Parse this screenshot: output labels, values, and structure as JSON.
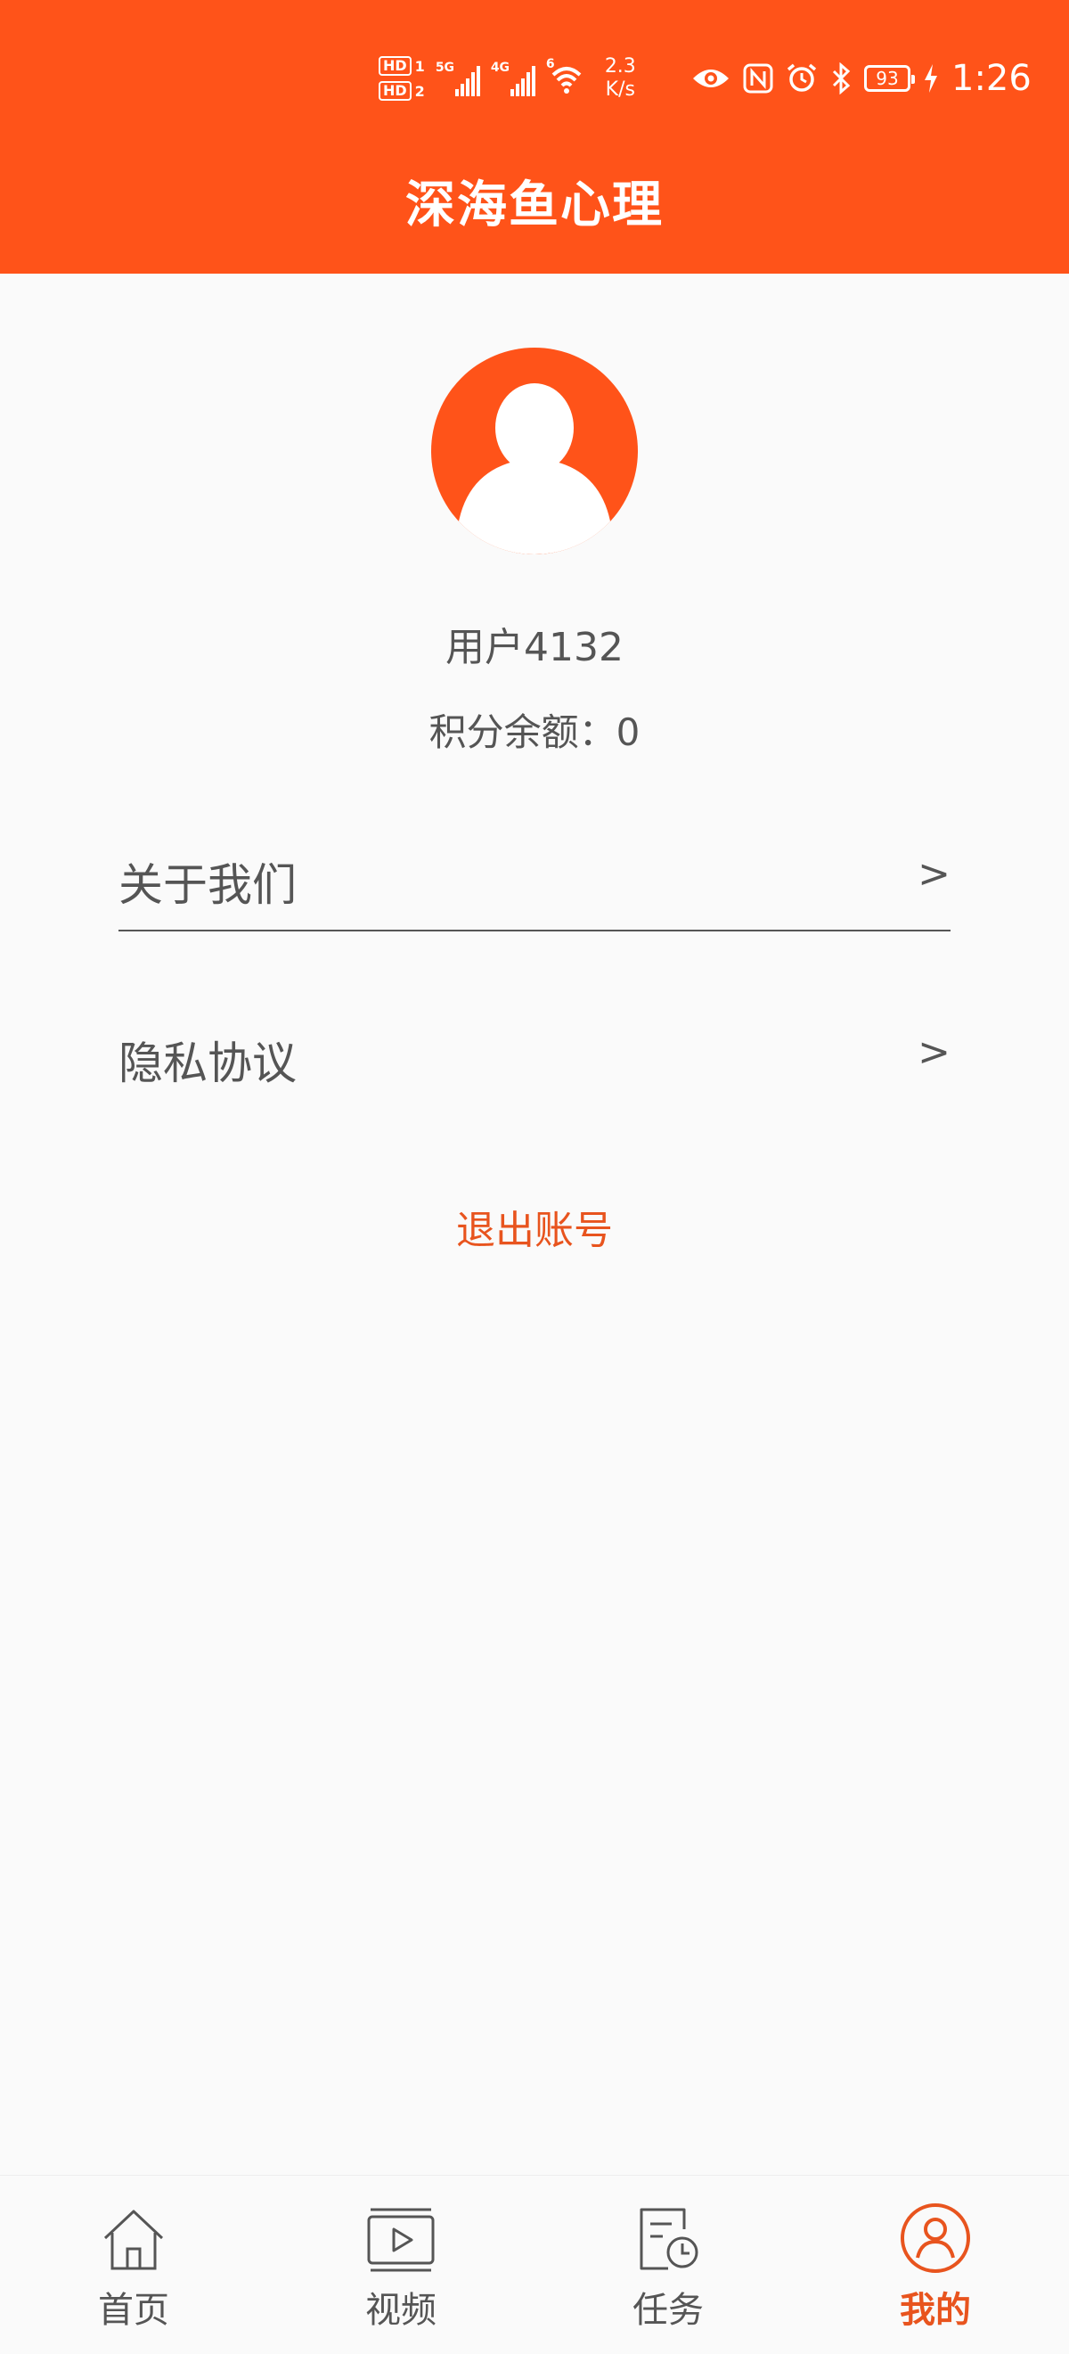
{
  "status_bar": {
    "sim1": "HD",
    "sim1_num": "1",
    "sim2": "HD",
    "sim2_num": "2",
    "net1": "5G",
    "net2": "4G",
    "wifi": "6",
    "speed_value": "2.3",
    "speed_unit": "K/s",
    "battery": "93",
    "time": "1:26",
    "icons": [
      "eye-icon",
      "nfc-icon",
      "alarm-icon",
      "bluetooth-icon",
      "battery-icon",
      "charging-icon"
    ]
  },
  "header": {
    "title": "深海鱼心理"
  },
  "profile": {
    "username": "用户4132",
    "points_label": "积分余额：",
    "points_value": "0"
  },
  "menu": {
    "about": {
      "label": "关于我们",
      "arrow": ">"
    },
    "privacy": {
      "label": "隐私协议",
      "arrow": ">"
    }
  },
  "logout_label": "退出账号",
  "tabs": [
    {
      "label": "首页",
      "icon": "home-icon",
      "active": false
    },
    {
      "label": "视频",
      "icon": "video-icon",
      "active": false
    },
    {
      "label": "任务",
      "icon": "task-icon",
      "active": false
    },
    {
      "label": "我的",
      "icon": "profile-icon",
      "active": true
    }
  ],
  "colors": {
    "brand": "#ff5319",
    "accent_text": "#e8541e",
    "text": "#555555",
    "background": "#fafafa"
  }
}
